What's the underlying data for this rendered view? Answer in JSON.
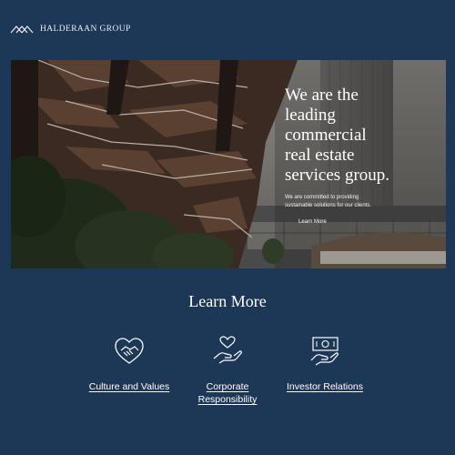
{
  "header": {
    "brand": "HALDERAAN GROUP",
    "logo_icon": "mountain-chevrons-icon"
  },
  "hero": {
    "heading_lines": [
      "We are the",
      "leading",
      "commercial",
      "real estate",
      "services group."
    ],
    "subtext": "We are committed to providing sustainable solutions for our clients.",
    "link_label": "Learn More",
    "image": "vessel-building-and-glass-tower-photo"
  },
  "learn_more": {
    "title": "Learn More",
    "items": [
      {
        "label": "Culture and Values",
        "icon": "handshake-heart-icon"
      },
      {
        "label": "Corporate Responsibility",
        "icon": "hand-heart-icon"
      },
      {
        "label": "Investor Relations",
        "icon": "hand-money-icon"
      }
    ]
  },
  "colors": {
    "background": "#1d3856",
    "text": "#ffffff"
  }
}
